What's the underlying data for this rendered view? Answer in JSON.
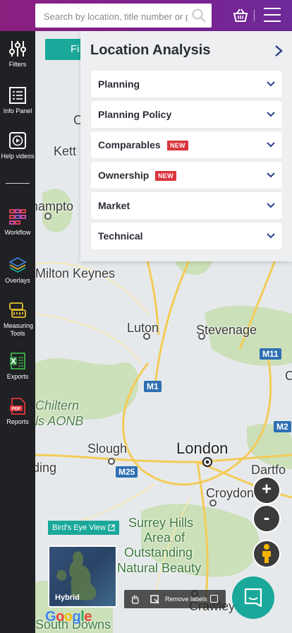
{
  "header": {
    "search_placeholder": "Search by location, title number or p"
  },
  "sidebar": {
    "items": [
      {
        "label": "Filters",
        "icon": "sliders-icon"
      },
      {
        "label": "Info Panel",
        "icon": "info-panel-icon"
      },
      {
        "label": "Help videos",
        "icon": "play-icon"
      },
      {
        "label": "Workflow",
        "icon": "workflow-icon"
      },
      {
        "label": "Overlays",
        "icon": "layers-icon"
      },
      {
        "label": "Measuring Tools",
        "icon": "measuring-tools-icon"
      },
      {
        "label": "Exports",
        "icon": "excel-icon"
      },
      {
        "label": "Reports",
        "icon": "pdf-icon"
      }
    ]
  },
  "filter_button": {
    "label": "Fi"
  },
  "panel": {
    "title": "Location Analysis",
    "sections": [
      {
        "label": "Planning",
        "badge": ""
      },
      {
        "label": "Planning Policy",
        "badge": ""
      },
      {
        "label": "Comparables",
        "badge": "NEW"
      },
      {
        "label": "Ownership",
        "badge": "NEW"
      },
      {
        "label": "Market",
        "badge": ""
      },
      {
        "label": "Technical",
        "badge": ""
      }
    ]
  },
  "map": {
    "places": {
      "kett": "Kett",
      "o": "O",
      "hampton": "hampto",
      "milton_keynes": "Milton Keynes",
      "luton": "Luton",
      "stevenage": "Stevenage",
      "chiltern": "Chiltern",
      "hills_aonb": "lls AONB",
      "slough": "Slough",
      "london": "London",
      "ding": "ding",
      "dartford": "Dartfo",
      "croydon": "Croydon",
      "surrey_hills": "Surrey Hills",
      "area_of": "Area of",
      "outstanding": "Outstanding",
      "natural_beauty": "Natural Beauty",
      "crawley": "Crawley",
      "south_downs": "South Downs",
      "c": "C"
    },
    "roads": {
      "m11": "M11",
      "m1": "M1",
      "m25": "M25",
      "m2": "M2"
    },
    "birds_eye": "Bird's Eye View",
    "hybrid": "Hybrid",
    "google": "Google",
    "remove_labels": "Remove labels",
    "zoom_in": "+",
    "zoom_out": "-"
  },
  "colors": {
    "header_purple": "#7a2290",
    "teal": "#1aa89a",
    "badge_red": "#d9363e",
    "sidebar_bg": "#202124"
  }
}
